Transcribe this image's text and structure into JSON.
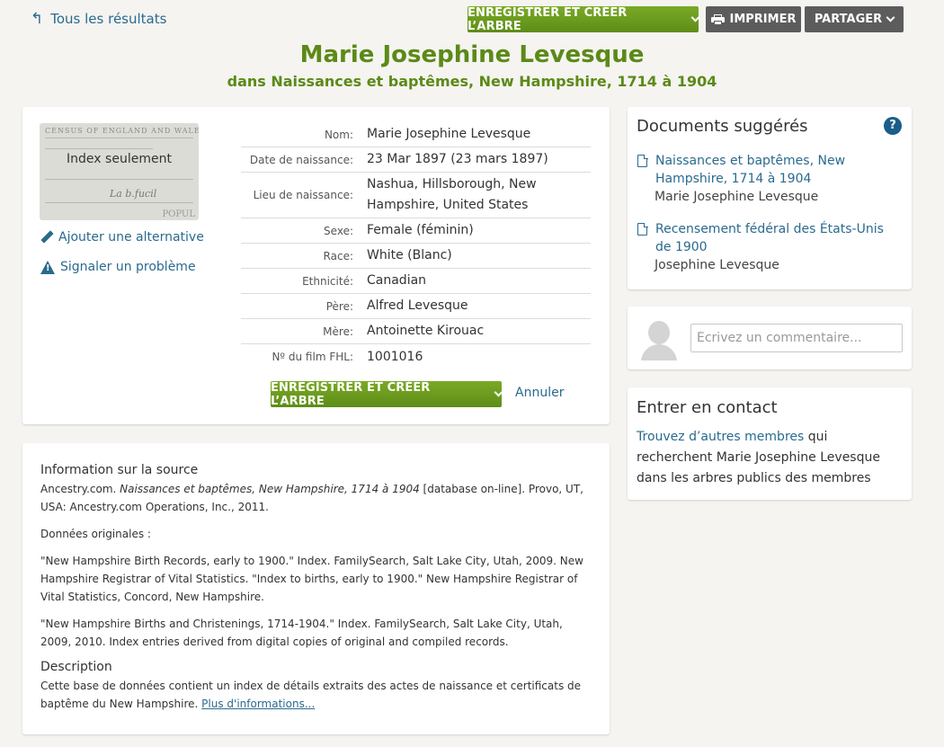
{
  "nav": {
    "back_label": "Tous les résultats",
    "save_tree_label": "ENREGISTRER ET CRÉER L’ARBRE",
    "print_label": "IMPRIMER",
    "share_label": "PARTAGER"
  },
  "header": {
    "title": "Marie Josephine Levesque",
    "subtitle": "dans Naissances et baptêmes, New Hampshire, 1714 à 1904"
  },
  "record": {
    "thumbnail_label": "Index seulement",
    "thumbnail_census_text": "CENSUS OF ENGLAND AND WALES",
    "thumbnail_popu": "POPUL",
    "add_alternative": "Ajouter une alternative",
    "report_problem": "Signaler un problème",
    "fields": [
      {
        "label": "Nom:",
        "value": "Marie Josephine Levesque"
      },
      {
        "label": "Date de naissance:",
        "value": "23 Mar 1897 (23 mars 1897)"
      },
      {
        "label": "Lieu de naissance:",
        "value": "Nashua, Hillsborough, New Hampshire, United States"
      },
      {
        "label": "Sexe:",
        "value": "Female (féminin)"
      },
      {
        "label": "Race:",
        "value": "White (Blanc)"
      },
      {
        "label": "Ethnicité:",
        "value": "Canadian"
      },
      {
        "label": "Père:",
        "value": "Alfred Levesque"
      },
      {
        "label": "Mère:",
        "value": "Antoinette Kirouac"
      },
      {
        "label": "Nº du film FHL:",
        "value": "1001016"
      }
    ],
    "save_tree_label": "ENREGISTRER ET CRÉER L’ARBRE",
    "cancel_label": "Annuler"
  },
  "source": {
    "heading": "Information sur la source",
    "citation_prefix": "Ancestry.com. ",
    "citation_title": "Naissances et baptêmes, New Hampshire, 1714 à 1904",
    "citation_suffix": " [database on-line]. Provo, UT, USA: Ancestry.com Operations, Inc., 2011.",
    "original_data_label": "Données originales :",
    "original_data_1": "\"New Hampshire Birth Records, early to 1900.\" Index. FamilySearch, Salt Lake City, Utah, 2009. New Hampshire Registrar of Vital Statistics. \"Index to births, early to 1900.\" New Hampshire Registrar of Vital Statistics, Concord, New Hampshire.",
    "original_data_2": "\"New Hampshire Births and Christenings, 1714-1904.\" Index. FamilySearch, Salt Lake City, Utah, 2009, 2010. Index entries derived from digital copies of original and compiled records.",
    "description_heading": "Description",
    "description_text": "Cette base de données contient un index de détails extraits des actes de naissance et certificats de baptême du New Hampshire. ",
    "more_info_label": "Plus d'informations..."
  },
  "suggested": {
    "title": "Documents suggérés",
    "help_icon": "?",
    "items": [
      {
        "title": "Naissances et baptêmes, New Hampshire, 1714 à 1904",
        "name": "Marie Josephine Levesque"
      },
      {
        "title": "Recensement fédéral des États-Unis de 1900",
        "name": "Josephine Levesque"
      }
    ]
  },
  "comment": {
    "placeholder": "Écrivez un commentaire..."
  },
  "contact": {
    "title": "Entrer en contact",
    "link_text": "Trouvez d’autres membres",
    "text": " qui recherchent Marie Josephine Levesque dans les arbres publics des membres"
  },
  "colors": {
    "title_green": "#5b8a17",
    "button_green": "#6a9a1f",
    "button_dark": "#5c5c5c",
    "link_blue": "#2a6a8e",
    "help_blue": "#1a5d8a",
    "background": "#f5f4f1"
  },
  "icons": {
    "back": "back-arrow-icon",
    "printer": "printer-icon",
    "pencil": "pencil-icon",
    "warning": "warning-icon",
    "document": "document-icon",
    "help": "help-icon",
    "avatar": "avatar-silhouette-icon",
    "chevron": "chevron-down-icon"
  }
}
